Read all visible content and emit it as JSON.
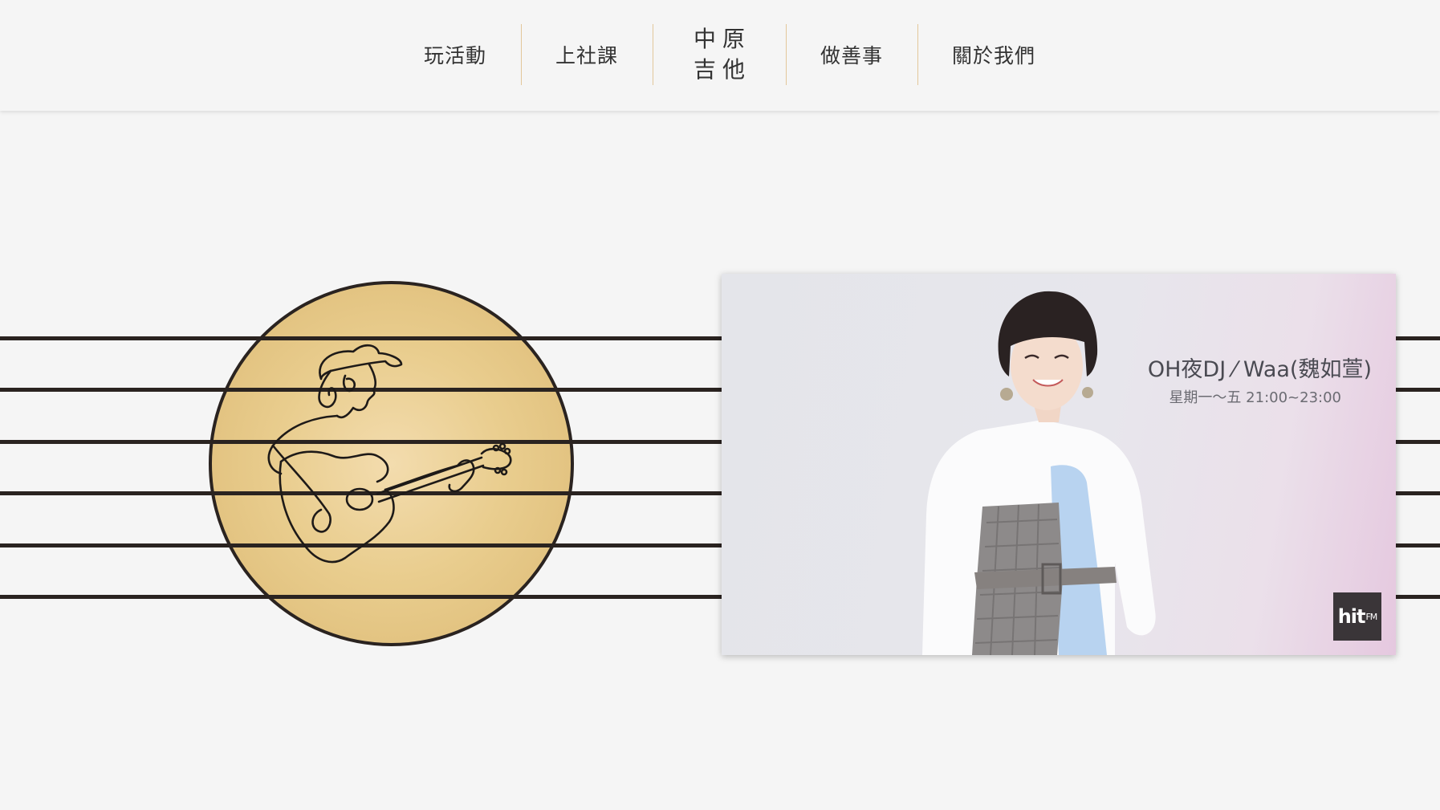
{
  "nav": {
    "items": [
      {
        "label": "玩活動"
      },
      {
        "label": "上社課"
      },
      {
        "label": "做善事"
      },
      {
        "label": "關於我們"
      }
    ],
    "logo": {
      "line1": "中原",
      "line2": "吉他"
    }
  },
  "hero": {
    "illustration": "guitarist-line-art",
    "sun_color": "#e7c98a",
    "string_color": "#2a2320",
    "string_count": 6
  },
  "video": {
    "title": "OH夜DJ ⁄ Waa(魏如萱)",
    "schedule": "星期一～五 21:00~23:00",
    "logo_main": "hit",
    "logo_sub": "FM"
  },
  "colors": {
    "background": "#f5f5f5",
    "nav_divider": "#e3c79a",
    "text": "#333333"
  }
}
